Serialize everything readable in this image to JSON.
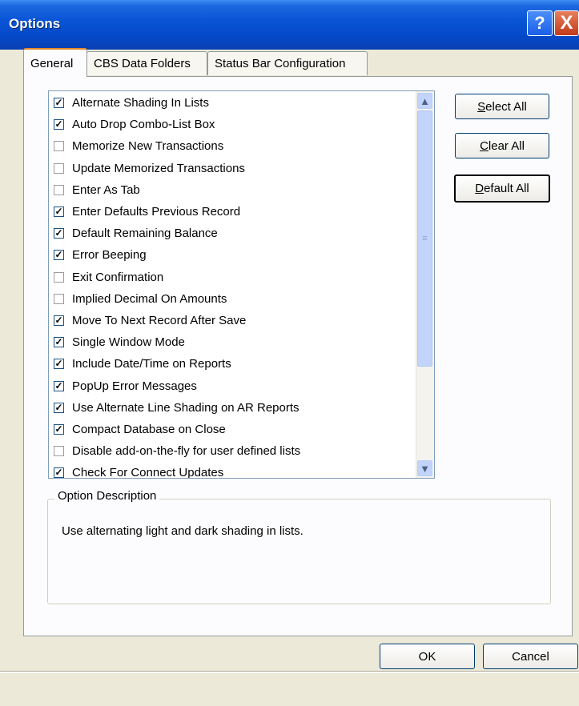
{
  "window": {
    "title": "Options",
    "help_label": "?",
    "close_label": "X"
  },
  "tabs": [
    {
      "label": "General",
      "active": true
    },
    {
      "label": "CBS Data Folders",
      "active": false
    },
    {
      "label": "Status Bar Configuration",
      "active": false
    }
  ],
  "options": [
    {
      "label": "Alternate Shading In Lists",
      "checked": true
    },
    {
      "label": "Auto Drop Combo-List Box",
      "checked": true
    },
    {
      "label": "Memorize New Transactions",
      "checked": false
    },
    {
      "label": "Update Memorized Transactions",
      "checked": false
    },
    {
      "label": "Enter As Tab",
      "checked": false
    },
    {
      "label": "Enter Defaults Previous Record",
      "checked": true
    },
    {
      "label": "Default Remaining Balance",
      "checked": true
    },
    {
      "label": "Error Beeping",
      "checked": true
    },
    {
      "label": "Exit Confirmation",
      "checked": false
    },
    {
      "label": "Implied Decimal On Amounts",
      "checked": false
    },
    {
      "label": "Move To Next Record After Save",
      "checked": true
    },
    {
      "label": "Single Window Mode",
      "checked": true
    },
    {
      "label": "Include Date/Time on Reports",
      "checked": true
    },
    {
      "label": "PopUp Error Messages",
      "checked": true
    },
    {
      "label": "Use Alternate Line Shading on AR Reports",
      "checked": true
    },
    {
      "label": "Compact Database on Close",
      "checked": true
    },
    {
      "label": "Disable add-on-the-fly for user defined lists",
      "checked": false
    },
    {
      "label": "Check For Connect Updates",
      "checked": true
    }
  ],
  "buttons": {
    "select_all": {
      "first": "S",
      "rest": "elect All"
    },
    "clear_all": {
      "first": "C",
      "rest": "lear All"
    },
    "default_all": {
      "first": "D",
      "rest": "efault All"
    },
    "ok": "OK",
    "cancel": "Cancel"
  },
  "description": {
    "title": "Option Description",
    "text": "Use alternating light and dark shading in lists."
  },
  "colors": {
    "title_bar": "#0a55d6",
    "tab_highlight": "#e68b2c",
    "dialog_bg": "#ece9d8"
  }
}
